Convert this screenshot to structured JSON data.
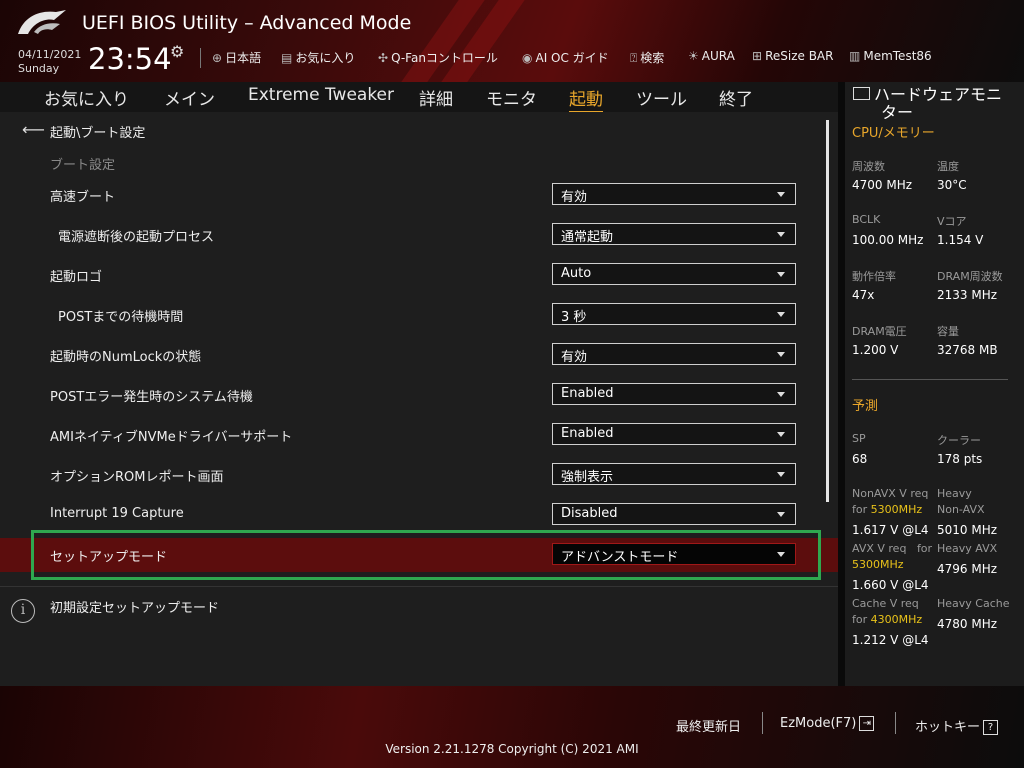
{
  "app": {
    "title": "UEFI BIOS Utility – Advanced Mode"
  },
  "clock": {
    "date": "04/11/2021",
    "day": "Sunday",
    "time": "23:54"
  },
  "toolbar": [
    {
      "label": "日本語",
      "icon": "globe-icon"
    },
    {
      "label": "お気に入り",
      "icon": "favorites-icon"
    },
    {
      "label": "Q-Fanコントロール",
      "icon": "fan-icon"
    },
    {
      "label": "AI OC ガイド",
      "icon": "ai-guide-icon"
    },
    {
      "label": "検索",
      "icon": "search-icon"
    },
    {
      "label": "AURA",
      "icon": "aura-icon"
    },
    {
      "label": "ReSize BAR",
      "icon": "resize-bar-icon"
    },
    {
      "label": "MemTest86",
      "icon": "memtest-icon"
    }
  ],
  "tabs": [
    {
      "label": "お気に入り",
      "active": false
    },
    {
      "label": "メイン",
      "active": false
    },
    {
      "label": "Extreme Tweaker",
      "active": false
    },
    {
      "label": "詳細",
      "active": false
    },
    {
      "label": "モニタ",
      "active": false
    },
    {
      "label": "起動",
      "active": true
    },
    {
      "label": "ツール",
      "active": false
    },
    {
      "label": "終了",
      "active": false
    }
  ],
  "breadcrumb": "起動\\ブート設定",
  "section_title": "ブート設定",
  "settings": [
    {
      "label": "高速ブート",
      "value": "有効"
    },
    {
      "label": "電源遮断後の起動プロセス",
      "value": "通常起動"
    },
    {
      "label": "起動ロゴ",
      "value": "Auto"
    },
    {
      "label": "POSTまでの待機時間",
      "value": "3 秒"
    },
    {
      "label": "起動時のNumLockの状態",
      "value": "有効"
    },
    {
      "label": "POSTエラー発生時のシステム待機",
      "value": "Enabled"
    },
    {
      "label": "AMIネイティブNVMeドライバーサポート",
      "value": "Enabled"
    },
    {
      "label": "オプションROMレポート画面",
      "value": "強制表示"
    },
    {
      "label": "Interrupt 19 Capture",
      "value": "Disabled"
    },
    {
      "label": "セットアップモード",
      "value": "アドバンストモード",
      "selected": true
    }
  ],
  "help_text": "初期設定セットアップモード",
  "hw_monitor": {
    "title_line1": "ハードウェアモニ",
    "title_line2": "ター",
    "cpu_section": "CPU/メモリー",
    "cpu": [
      {
        "label": "周波数",
        "value": "4700 MHz"
      },
      {
        "label": "温度",
        "value": "30°C"
      },
      {
        "label": "BCLK",
        "value": "100.00 MHz"
      },
      {
        "label": "Vコア",
        "value": "1.154 V"
      },
      {
        "label": "動作倍率",
        "value": "47x"
      },
      {
        "label": "DRAM周波数",
        "value": "2133 MHz"
      },
      {
        "label": "DRAM電圧",
        "value": "1.200 V"
      },
      {
        "label": "容量",
        "value": "32768 MB"
      }
    ],
    "predict_section": "予測",
    "sp_label": "SP",
    "sp_value": "68",
    "cooler_label": "クーラー",
    "cooler_value": "178 pts",
    "nonavx_req_line1": "NonAVX V req",
    "for_label": "for",
    "nonavx_freq": "5300MHz",
    "nonavx_req_value": "1.617 V @L4",
    "heavy_nonavx_line1": "Heavy",
    "heavy_nonavx_line2": "Non-AVX",
    "heavy_nonavx_value": "5010 MHz",
    "avx_req_line1": "AVX V req",
    "avx_for_label": "for",
    "avx_freq": "5300MHz",
    "avx_req_value": "1.660 V @L4",
    "heavy_avx_label": "Heavy AVX",
    "heavy_avx_value": "4796 MHz",
    "cache_req_line1": "Cache V req",
    "cache_for_label": "for",
    "cache_freq": "4300MHz",
    "cache_req_value": "1.212 V @L4",
    "heavy_cache_label": "Heavy Cache",
    "heavy_cache_value": "4780 MHz"
  },
  "footer": {
    "last_modified": "最終更新日",
    "ezmode": "EzMode(F7)",
    "hotkeys": "ホットキー",
    "hotkey_glyph": "?",
    "version": "Version 2.21.1278 Copyright (C) 2021 AMI"
  },
  "colors": {
    "accent": "#e8a62b",
    "selected_row": "#5c0d0d",
    "highlight_box": "#2fa84f",
    "freq_yellow": "#e8c21a"
  }
}
